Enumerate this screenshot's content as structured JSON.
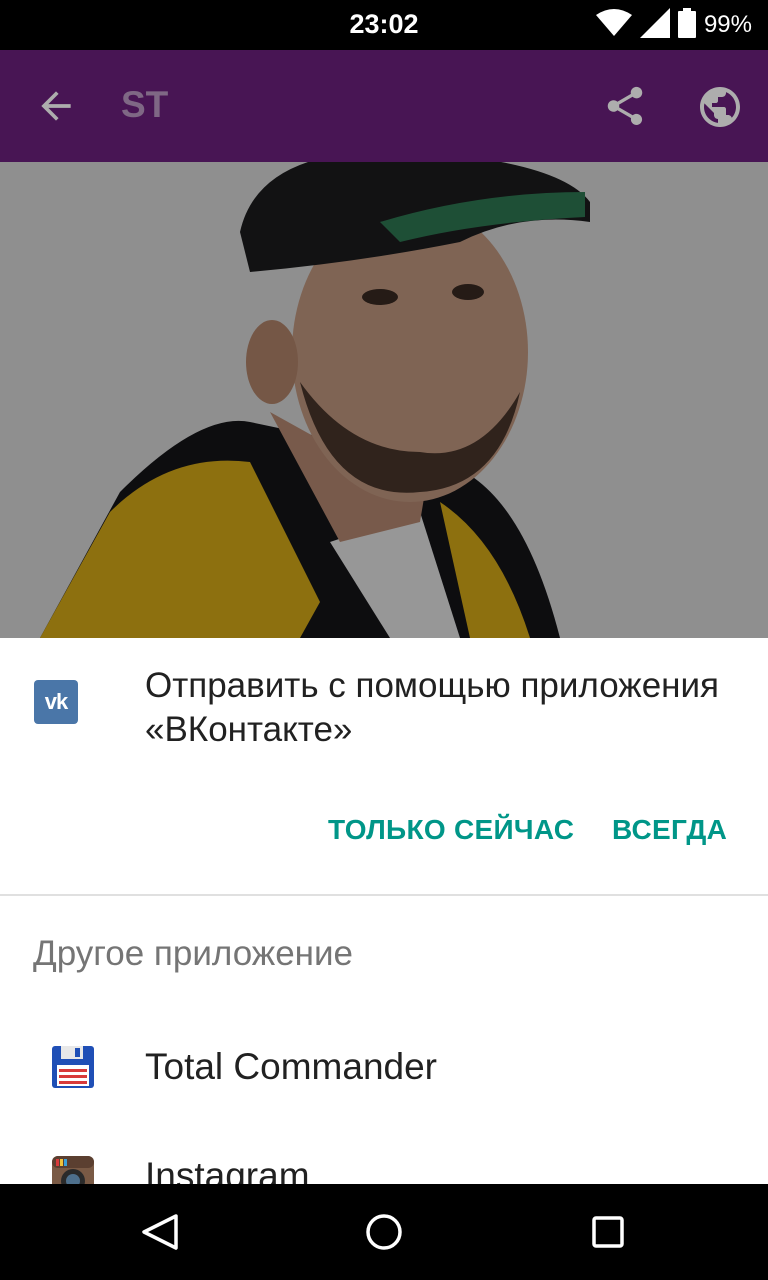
{
  "status_bar": {
    "time": "23:02",
    "battery": "99%",
    "icons": [
      "wifi-icon",
      "signal-icon",
      "battery-icon"
    ]
  },
  "toolbar": {
    "title": "ST",
    "background_color": "#6b1f7c",
    "icons": [
      "back-arrow-icon",
      "share-icon",
      "globe-icon"
    ]
  },
  "share_sheet": {
    "app_icon_text": "vk",
    "title": "Отправить с помощью приложения «ВКонтакте»",
    "just_once_label": "ТОЛЬКО СЕЙЧАС",
    "always_label": "ВСЕГДА",
    "accent_color": "#009688",
    "other_heading": "Другое приложение",
    "apps": [
      {
        "label": "Total Commander",
        "icon": "floppy-disk-icon"
      },
      {
        "label": "Instagram",
        "icon": "instagram-camera-icon"
      }
    ]
  },
  "nav_bar": {
    "icons": [
      "nav-back-icon",
      "nav-home-icon",
      "nav-recents-icon"
    ]
  }
}
